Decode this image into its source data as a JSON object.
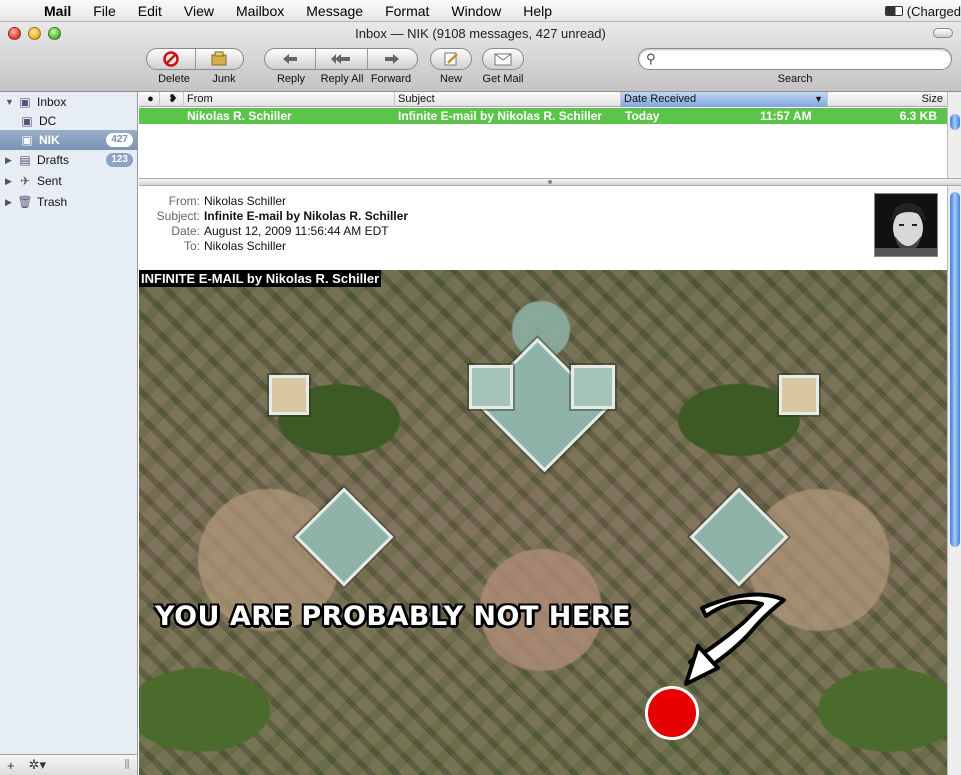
{
  "menubar": {
    "items": [
      "Mail",
      "File",
      "Edit",
      "View",
      "Mailbox",
      "Message",
      "Format",
      "Window",
      "Help"
    ],
    "battery_status": "(Charged"
  },
  "window": {
    "title": "Inbox — NIK (9108 messages, 427 unread)"
  },
  "toolbar": {
    "delete": "Delete",
    "junk": "Junk",
    "reply": "Reply",
    "reply_all": "Reply All",
    "forward": "Forward",
    "new": "New",
    "get_mail": "Get Mail",
    "search_label": "Search",
    "search_placeholder": ""
  },
  "sidebar": {
    "inbox": "Inbox",
    "dc": "DC",
    "nik": "NIK",
    "nik_badge": "427",
    "drafts": "Drafts",
    "drafts_badge": "123",
    "sent": "Sent",
    "trash": "Trash",
    "add": "+",
    "gear": "✲▾"
  },
  "list": {
    "columns": {
      "from": "From",
      "subject": "Subject",
      "date": "Date Received",
      "size": "Size"
    },
    "row": {
      "from": "Nikolas R. Schiller",
      "subject": "Infinite E-mail by Nikolas R. Schiller",
      "date": "Today",
      "time": "11:57 AM",
      "size": "6.3 KB"
    }
  },
  "message": {
    "from_label": "From:",
    "from": "Nikolas Schiller",
    "subject_label": "Subject:",
    "subject": "Infinite E-mail by Nikolas R. Schiller",
    "date_label": "Date:",
    "date": "August 12, 2009 11:56:44 AM EDT",
    "to_label": "To:",
    "to": "Nikolas Schiller",
    "image_title": "INFINITE E-MAIL by Nikolas R. Schiller",
    "overlay_text": "YOU ARE PROBABLY NOT HERE"
  },
  "colors": {
    "selected_row": "#5cc44b",
    "marker": "#e60000"
  }
}
